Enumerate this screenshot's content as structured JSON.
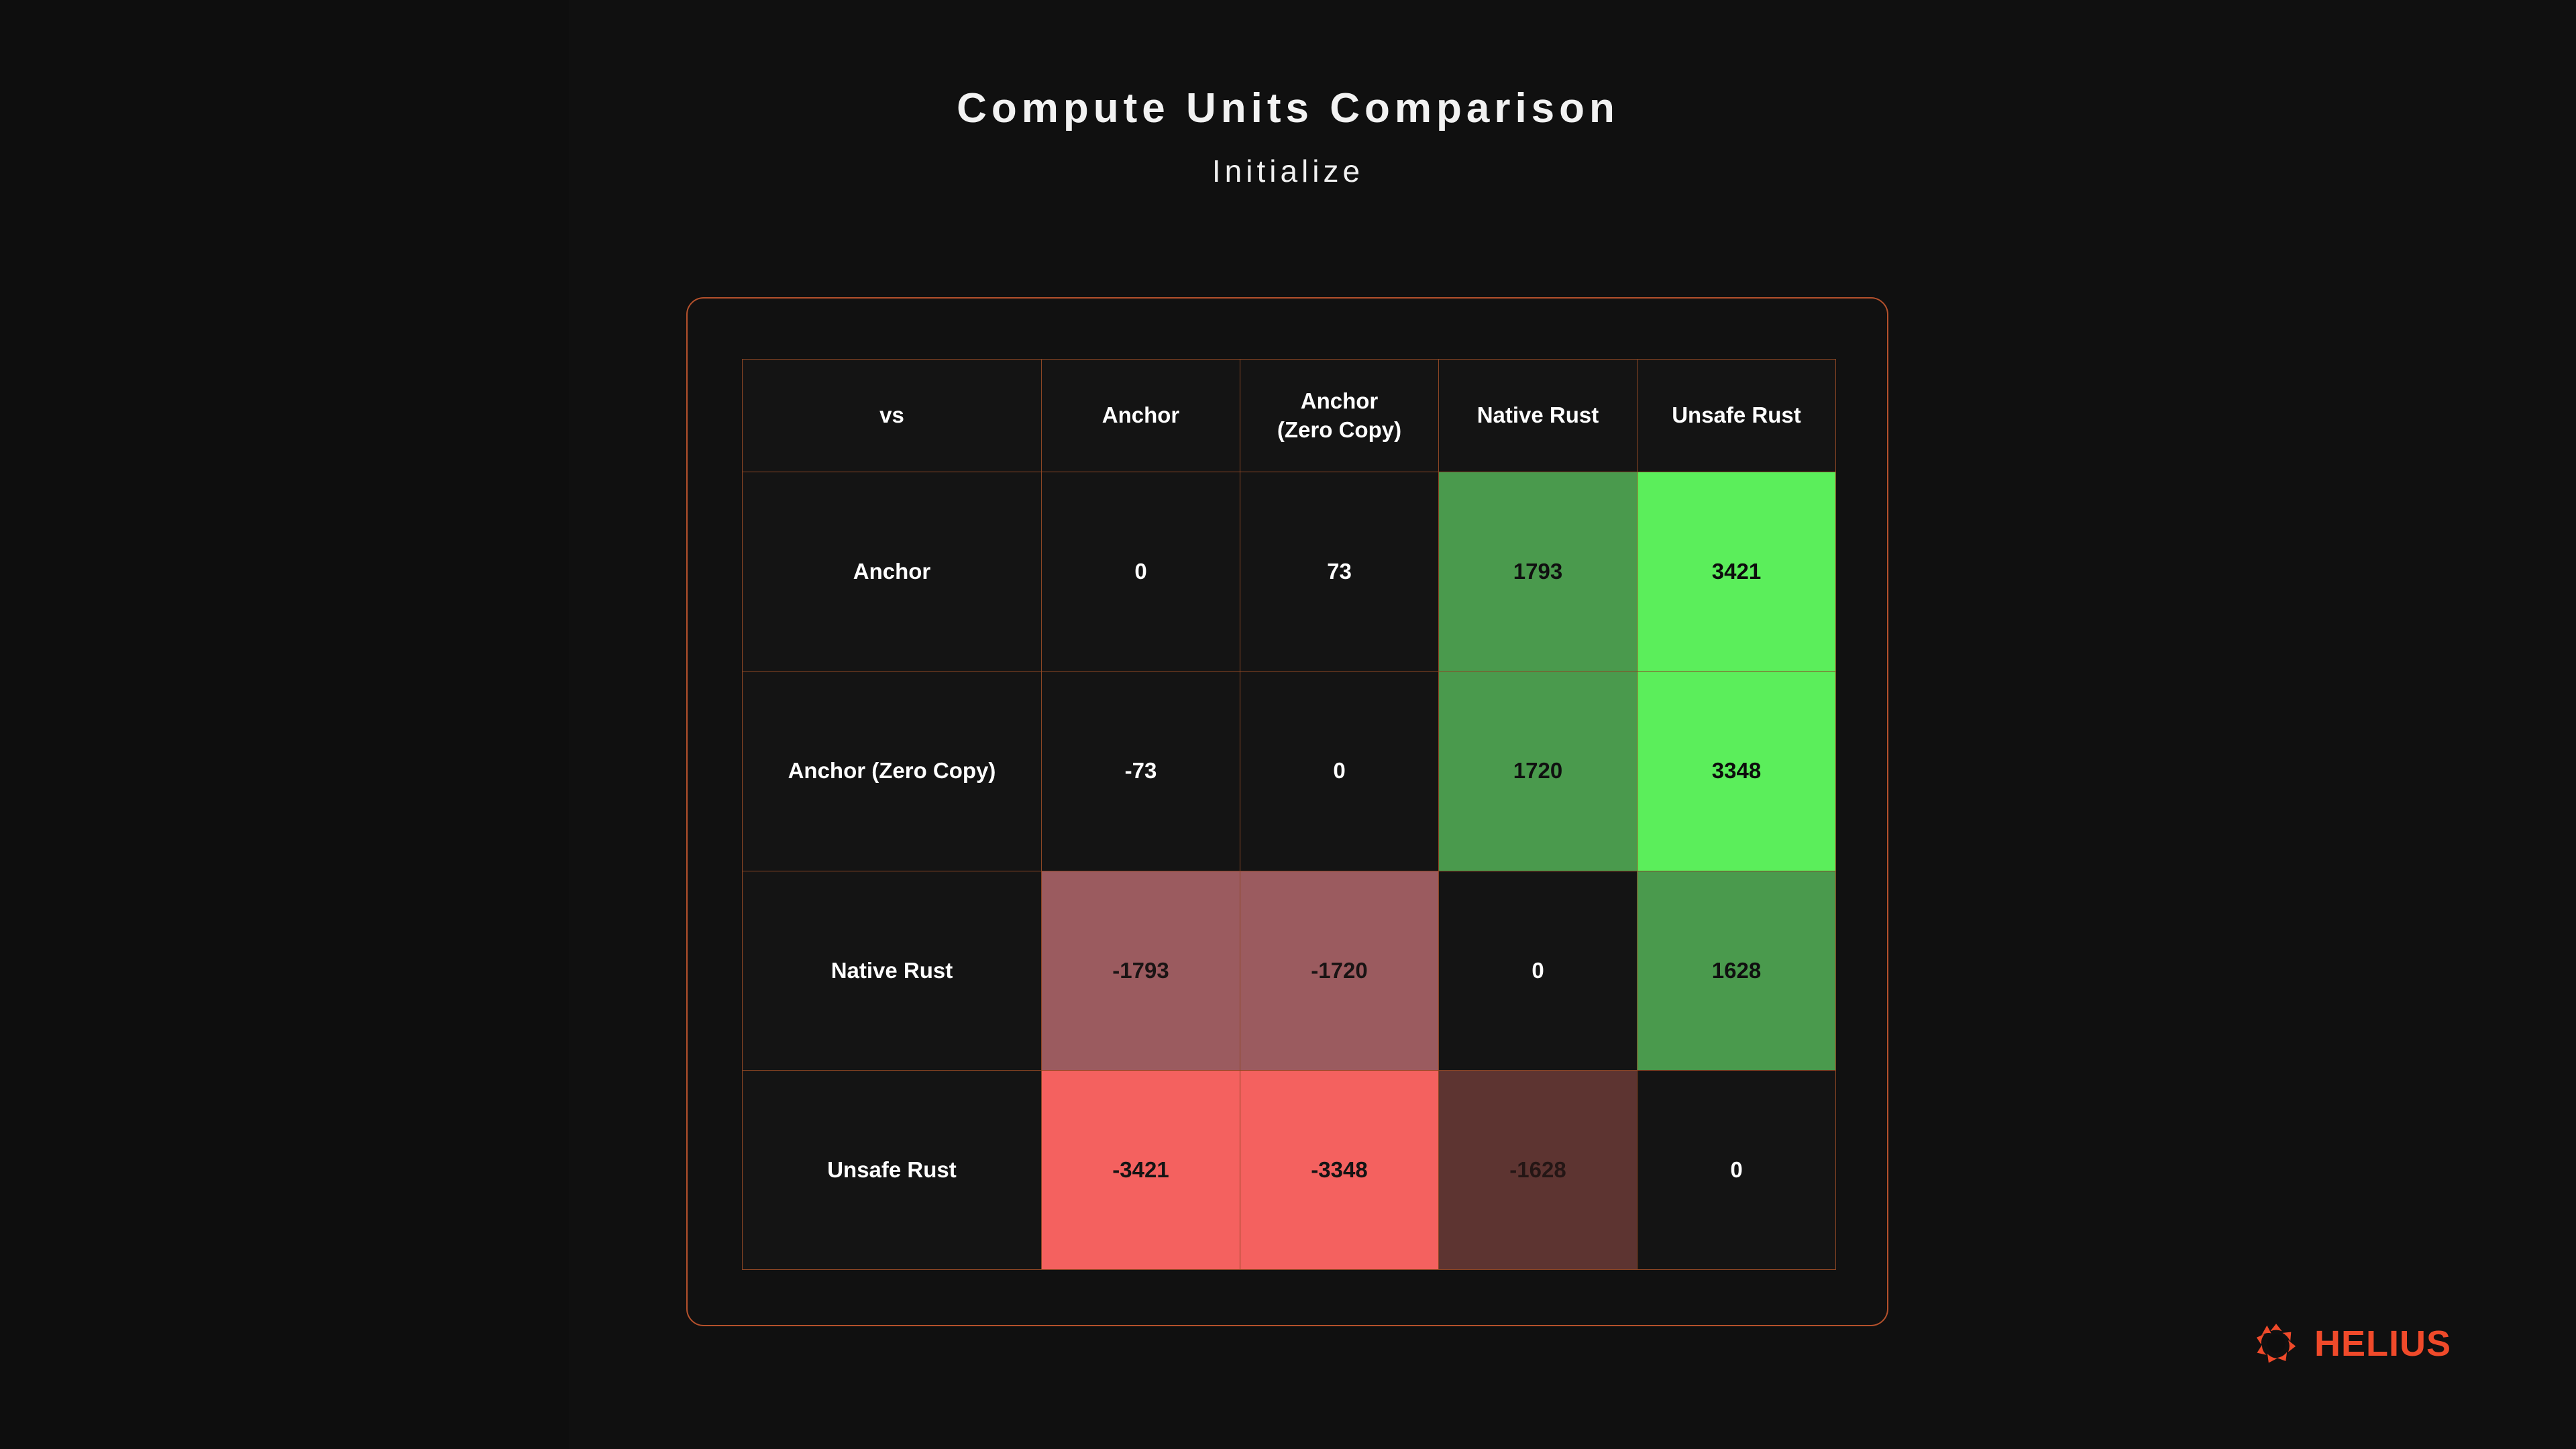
{
  "header": {
    "title": "Compute Units Comparison",
    "subtitle": "Initialize"
  },
  "brand": {
    "name": "HELIUS",
    "mark_icon": "helius-sun-icon",
    "color": "#f04a2a"
  },
  "theme": {
    "background": "#0e0e0e",
    "card_border": "#b5512c",
    "grid_line": "#8c4624",
    "text": "#ffffff",
    "green_bright": "#5bee5b",
    "green_mid": "#4a9a4d",
    "red_bright": "#f4615f",
    "red_mid": "#9b5b5f",
    "red_dark": "#5d3431",
    "neutral": "#141414"
  },
  "chart_data": {
    "type": "heatmap",
    "title": "Compute Units Comparison",
    "subtitle": "Initialize",
    "xlabel": "",
    "ylabel": "",
    "corner_label": "vs",
    "categories": [
      "Anchor",
      "Anchor (Zero Copy)",
      "Native Rust",
      "Unsafe Rust"
    ],
    "column_headers": [
      {
        "line1": "vs",
        "line2": ""
      },
      {
        "line1": "Anchor",
        "line2": ""
      },
      {
        "line1": "Anchor",
        "line2": "(Zero Copy)"
      },
      {
        "line1": "Native Rust",
        "line2": ""
      },
      {
        "line1": "Unsafe Rust",
        "line2": ""
      }
    ],
    "row_labels": [
      "Anchor",
      "Anchor (Zero Copy)",
      "Native Rust",
      "Unsafe Rust"
    ],
    "values": [
      [
        0,
        73,
        1793,
        3421
      ],
      [
        -73,
        0,
        1720,
        3348
      ],
      [
        -1793,
        -1720,
        0,
        1628
      ],
      [
        -3421,
        -3348,
        -1628,
        0
      ]
    ],
    "rows": [
      {
        "label": "Anchor",
        "cells": [
          {
            "text": "0",
            "heat": "neutral"
          },
          {
            "text": "73",
            "heat": "neutral"
          },
          {
            "text": "1793",
            "heat": "green-mid"
          },
          {
            "text": "3421",
            "heat": "green-bright"
          }
        ]
      },
      {
        "label": "Anchor (Zero Copy)",
        "cells": [
          {
            "text": "-73",
            "heat": "neutral"
          },
          {
            "text": "0",
            "heat": "neutral"
          },
          {
            "text": "1720",
            "heat": "green-mid"
          },
          {
            "text": "3348",
            "heat": "green-bright"
          }
        ]
      },
      {
        "label": "Native Rust",
        "cells": [
          {
            "text": "-1793",
            "heat": "red-mid"
          },
          {
            "text": "-1720",
            "heat": "red-mid"
          },
          {
            "text": "0",
            "heat": "neutral"
          },
          {
            "text": "1628",
            "heat": "green-mid"
          }
        ]
      },
      {
        "label": "Unsafe Rust",
        "cells": [
          {
            "text": "-3421",
            "heat": "red-bright"
          },
          {
            "text": "-3348",
            "heat": "red-bright"
          },
          {
            "text": "-1628",
            "heat": "red-dark"
          },
          {
            "text": "0",
            "heat": "neutral"
          }
        ]
      }
    ],
    "grid": true,
    "legend": "none"
  }
}
